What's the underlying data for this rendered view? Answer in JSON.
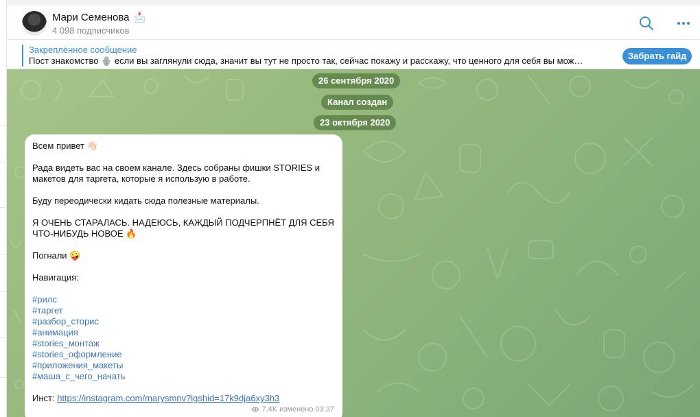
{
  "header": {
    "channel_name": "Мари Семенова",
    "channel_name_emoji": "📩",
    "subscribers": "4 098 подписчиков"
  },
  "pinned": {
    "title": "Закреплённое сообщение",
    "text": "Пост знакомство 🪬  если вы заглянули сюда, значит вы тут не просто так, сейчас покажу и расскажу, что ценного для себя вы мож…",
    "button_label": "Забрать гайд"
  },
  "chat": {
    "date_1": "26 сентября 2020",
    "service_1": "Канал создан",
    "date_2": "23 октября 2020"
  },
  "message": {
    "greeting": "Всем привет 👋🏻",
    "para_1": "Рада видеть вас на своем канале. Здесь собраны фишки STORIES и макетов для таргета, которые я использую в работе.",
    "para_2": "Буду переодически кидать сюда полезные материалы.",
    "para_3": "Я ОЧЕНЬ СТАРАЛАСЬ. НАДЕЮСЬ, КАЖДЫЙ ПОДЧЕРПНЁТ ДЛЯ СЕБЯ ЧТО-НИБУДЬ НОВОЕ 🔥",
    "para_4": "Погнали 🤪",
    "nav_label": "Навигация:",
    "hashtags": [
      "#рилс",
      "#таргет",
      "#разбор_сторис",
      "#анимация",
      "#stories_монтаж",
      "#stories_оформление",
      "#приложения_макеты",
      "#маша_с_чего_начать"
    ],
    "insta_label": "Инст: ",
    "insta_link": "https://instagram.com/marysmnv?igshid=17k9dja6xy3h3",
    "views": "7,4K",
    "edited": "изменено 03:37"
  },
  "colors": {
    "accent": "#3a8fd6",
    "chat_bg": "#97b97e",
    "link": "#3a72b8"
  },
  "icons": [
    "search-icon",
    "more-icon",
    "eye-icon",
    "pin-bar"
  ]
}
